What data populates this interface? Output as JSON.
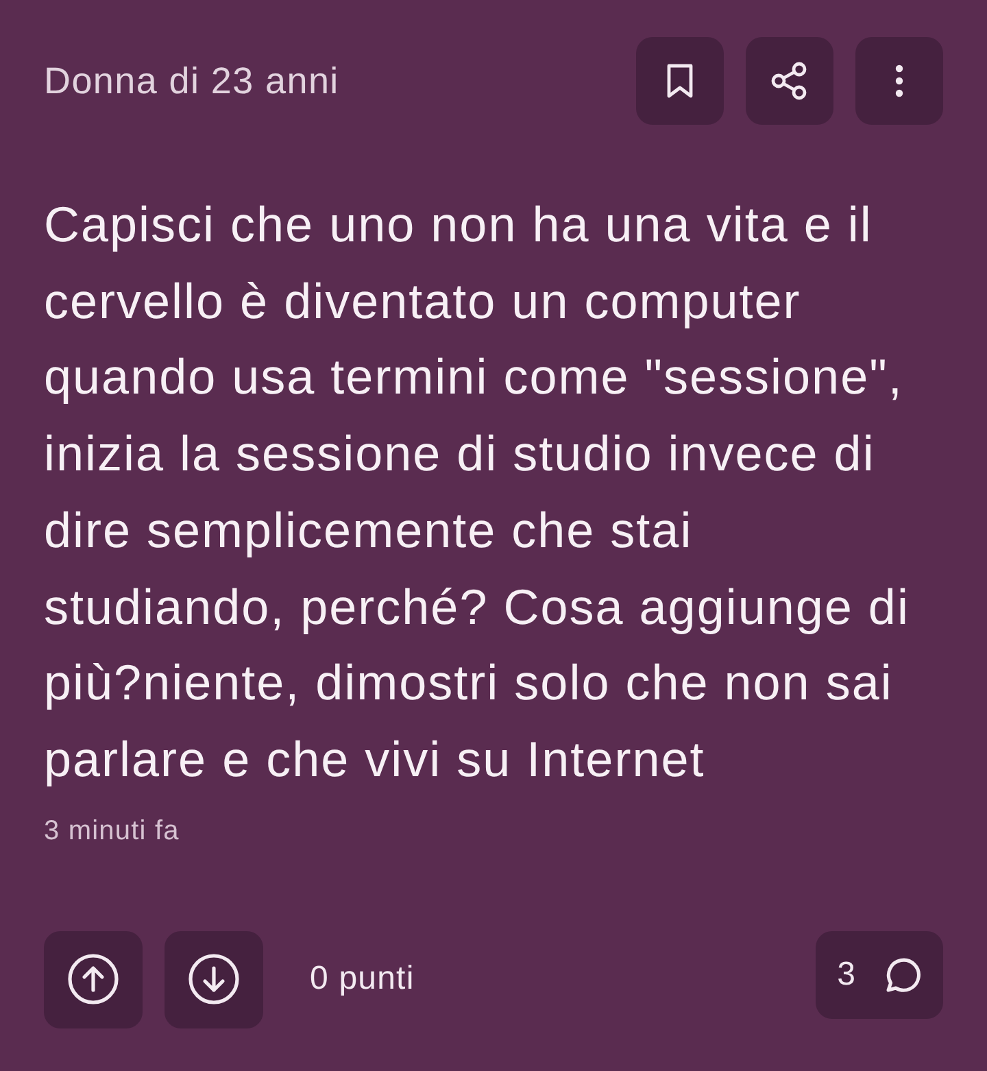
{
  "post": {
    "author": "Donna di 23 anni",
    "body": "Capisci che uno non ha una vita e il cervello è diventato un computer quando usa termini come \"sessione\", inizia la sessione di studio invece di dire semplicemente che stai studiando, perché? Cosa aggiunge di più?niente, dimostri solo che non sai parlare e che vivi su Internet",
    "time": "3 minuti fa"
  },
  "footer": {
    "score": "0 punti",
    "comment_count": "3"
  }
}
